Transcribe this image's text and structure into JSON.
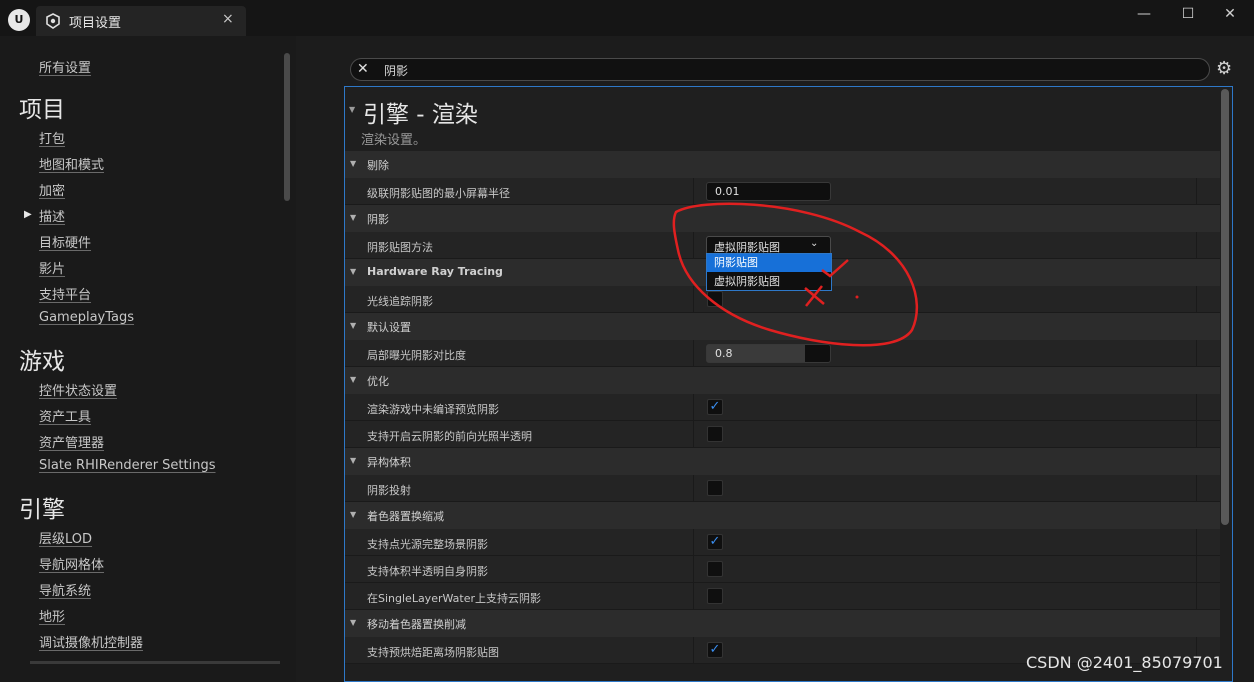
{
  "window": {
    "tab_title": "项目设置",
    "tab_close": "×",
    "logo_text": "U",
    "minimize": "—",
    "maximize": "☐",
    "close": "✕"
  },
  "nav": {
    "items": [
      "所有设置"
    ],
    "categories": [
      {
        "title": "项目",
        "items": [
          "打包",
          "地图和模式",
          "加密",
          "描述",
          "目标硬件",
          "影片",
          "支持平台",
          "GameplayTags"
        ]
      },
      {
        "title": "游戏",
        "items": [
          "控件状态设置",
          "资产工具",
          "资产管理器",
          "Slate RHIRenderer Settings"
        ]
      },
      {
        "title": "引擎",
        "items": [
          "层级LOD",
          "导航网格体",
          "导航系统",
          "地形",
          "调试摄像机控制器"
        ]
      }
    ],
    "expanded_marker": "▶"
  },
  "search": {
    "clear_icon": "✕",
    "query": "阴影"
  },
  "settings_icon": "⚙",
  "panel": {
    "title": "引擎 - 渲染",
    "subtitle": "渲染设置。",
    "sections": [
      {
        "label": "剔除",
        "props": [
          {
            "label": "级联阴影贴图的最小屏幕半径",
            "type": "number",
            "value": "0.01"
          }
        ]
      },
      {
        "label": "阴影",
        "props": [
          {
            "label": "阴影贴图方法",
            "type": "combo",
            "value": "虚拟阴影贴图"
          }
        ]
      },
      {
        "label": "Hardware Ray Tracing",
        "props": [
          {
            "label": "光线追踪阴影",
            "type": "check",
            "checked": false
          }
        ]
      },
      {
        "label": "默认设置",
        "props": [
          {
            "label": "局部曝光阴影对比度",
            "type": "slider",
            "value": "0.8",
            "fill_fraction": 0.8
          }
        ]
      },
      {
        "label": "优化",
        "props": [
          {
            "label": "渲染游戏中未编译预览阴影",
            "type": "check",
            "checked": true
          },
          {
            "label": "支持开启云阴影的前向光照半透明",
            "type": "check",
            "checked": false
          }
        ]
      },
      {
        "label": "异构体积",
        "props": [
          {
            "label": "阴影投射",
            "type": "check",
            "checked": false
          }
        ]
      },
      {
        "label": "着色器置换缩减",
        "props": [
          {
            "label": "支持点光源完整场景阴影",
            "type": "check",
            "checked": true
          },
          {
            "label": "支持体积半透明自身阴影",
            "type": "check",
            "checked": false
          },
          {
            "label": "在SingleLayerWater上支持云阴影",
            "type": "check",
            "checked": false
          }
        ]
      },
      {
        "label": "移动着色器置换削减",
        "props": [
          {
            "label": "支持预烘焙距离场阴影贴图",
            "type": "check",
            "checked": true
          }
        ]
      }
    ],
    "dropdown_options": [
      "阴影贴图",
      "虚拟阴影贴图"
    ],
    "dropdown_selected_index": 0
  },
  "watermark": "CSDN @2401_85079701",
  "colors": {
    "accent": "#2e78c8",
    "highlight": "#1770d8",
    "check": "#3a8ef0",
    "annotation": "#e02020"
  }
}
